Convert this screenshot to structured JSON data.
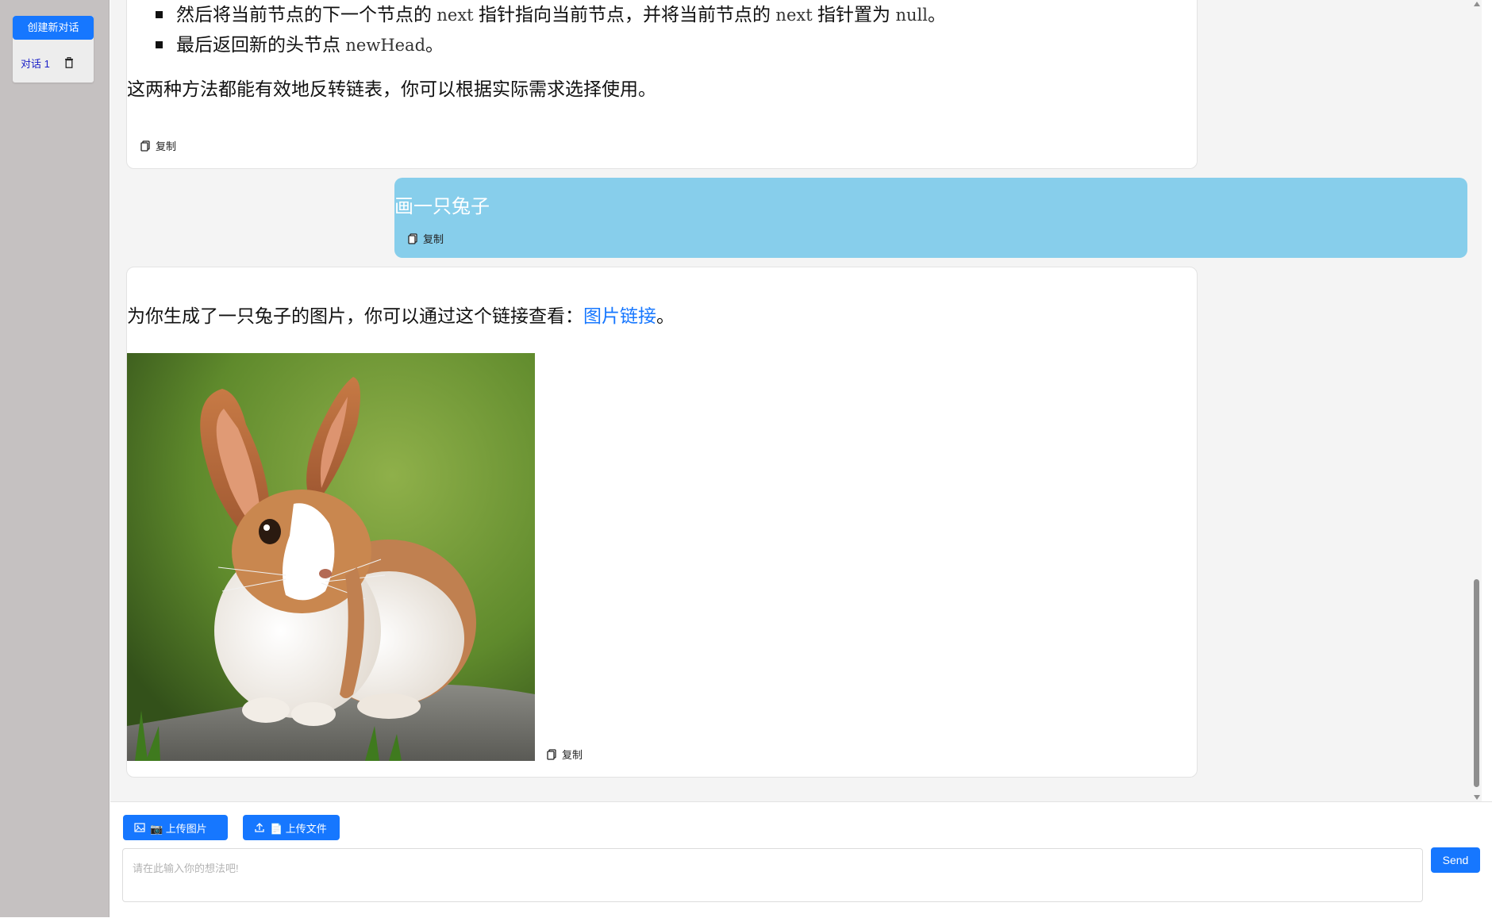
{
  "sidebar": {
    "new_chat_label": "创建新对话",
    "conversations": [
      {
        "label": "对话 1"
      }
    ]
  },
  "messages": {
    "ai_1": {
      "list_items": [
        {
          "parts": [
            "然后将当前节点的下一个节点的 ",
            "next",
            " 指针指向当前节点，并将当前节点的 ",
            "next",
            " 指针置为 ",
            "null",
            "。"
          ]
        },
        {
          "parts": [
            "最后返回新的头节点 ",
            "newHead",
            "。"
          ]
        }
      ],
      "paragraph": "这两种方法都能有效地反转链表，你可以根据实际需求选择使用。",
      "copy_label": "复制"
    },
    "user_1": {
      "text": "画一只兔子",
      "copy_label": "复制"
    },
    "ai_2": {
      "text_before": "为你生成了一只兔子的图片，你可以通过这个链接查看：",
      "link_text": "图片链接",
      "text_after": "。",
      "copy_label": "复制"
    }
  },
  "composer": {
    "upload_image_label": "📷 上传图片",
    "upload_file_label": "📄 上传文件",
    "placeholder": "请在此输入你的想法吧!",
    "send_label": "Send"
  },
  "colors": {
    "accent": "#1677ff",
    "user_bubble": "#87ceeb",
    "sidebar_bg": "#c5c1c1",
    "chat_bg": "#f4f4f4"
  }
}
